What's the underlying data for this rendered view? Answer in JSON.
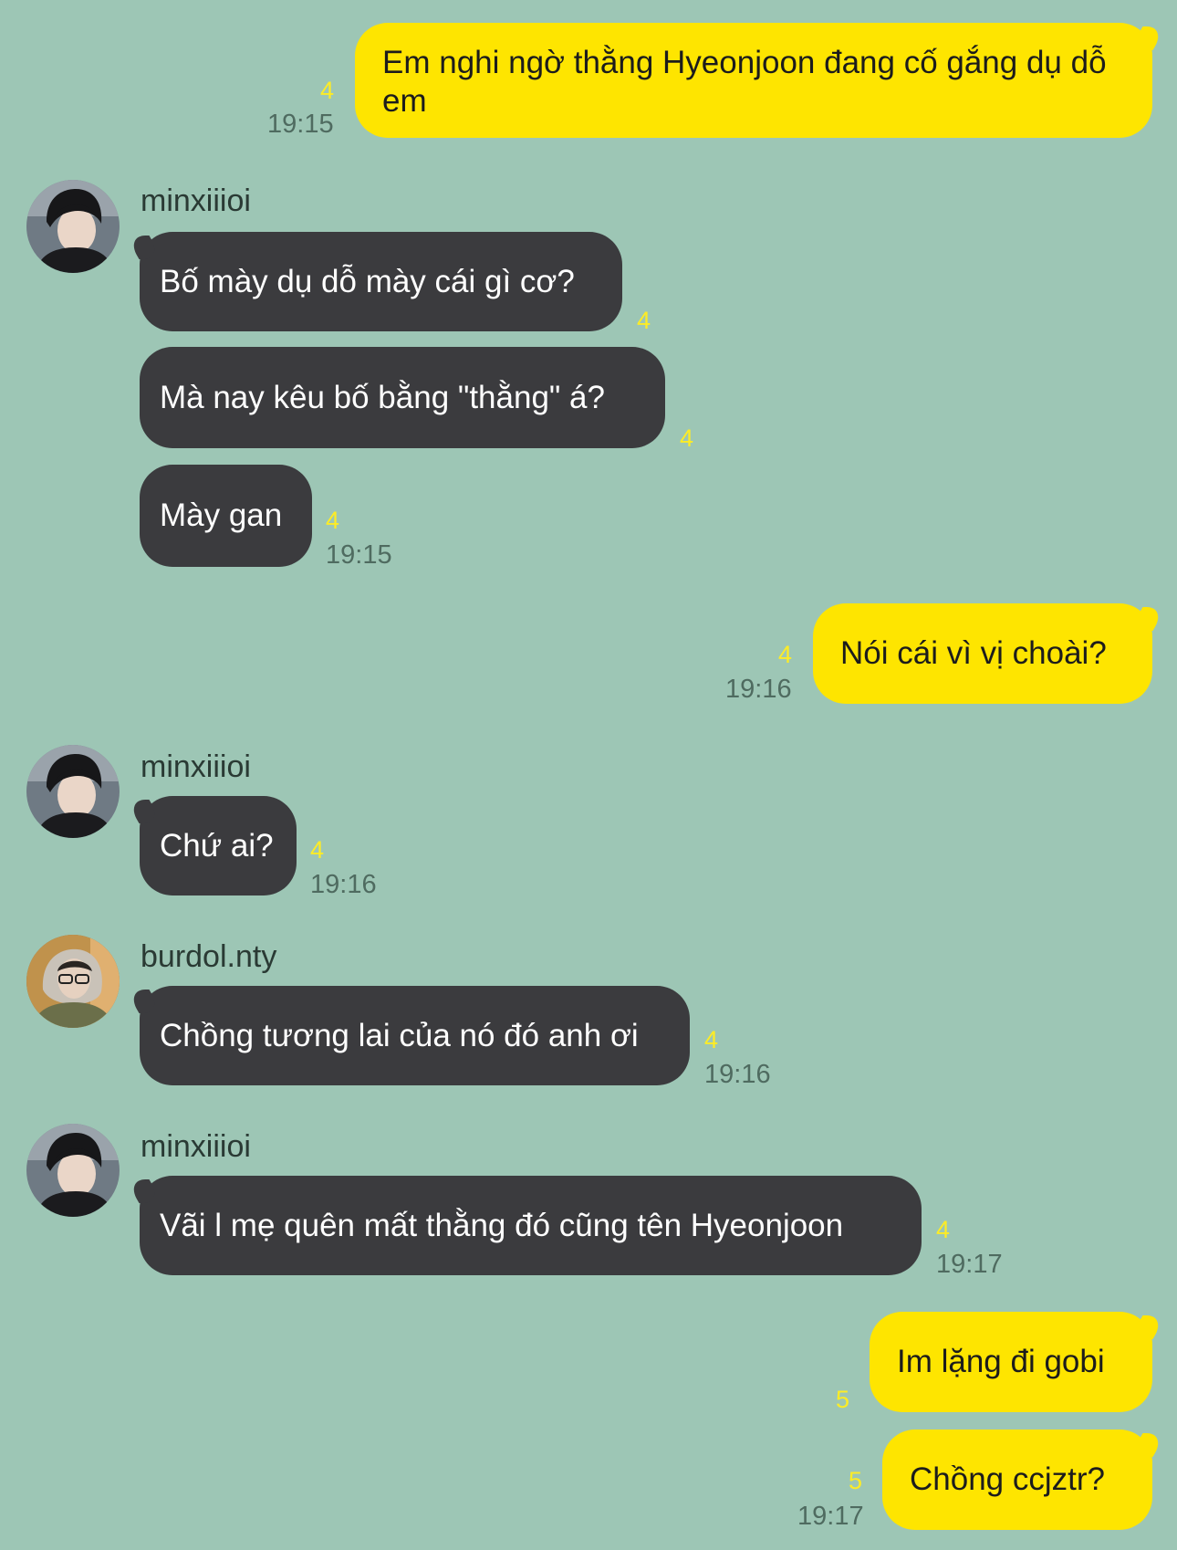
{
  "colors": {
    "background": "#9dc6b5",
    "my_bubble": "#fee500",
    "other_bubble": "#3b3b3e",
    "unread": "#fdec26",
    "time": "#4f6b60"
  },
  "messages": [
    {
      "text": "Em nghi ngờ thằng Hyeonjoon đang cố gắng dụ dỗ em",
      "unread": "4",
      "time": "19:15"
    },
    {
      "sender": "minxiiioi",
      "text": "Bố mày dụ dỗ mày cái gì cơ?",
      "unread": "4"
    },
    {
      "text": "Mà nay kêu bố bằng \"thằng\" á?",
      "unread": "4"
    },
    {
      "text": "Mày gan",
      "unread": "4",
      "time": "19:15"
    },
    {
      "text": "Nói cái vì vị choài?",
      "unread": "4",
      "time": "19:16"
    },
    {
      "sender": "minxiiioi",
      "text": "Chứ ai?",
      "unread": "4",
      "time": "19:16"
    },
    {
      "sender": "burdol.nty",
      "text": "Chồng tương lai của nó đó anh ơi",
      "unread": "4",
      "time": "19:16"
    },
    {
      "sender": "minxiiioi",
      "text": "Vãi l mẹ quên mất thằng đó cũng tên Hyeonjoon",
      "unread": "4",
      "time": "19:17"
    },
    {
      "text": "Im lặng đi gobi",
      "unread": "5"
    },
    {
      "text": "Chồng ccjztr?",
      "unread": "5",
      "time": "19:17"
    }
  ]
}
